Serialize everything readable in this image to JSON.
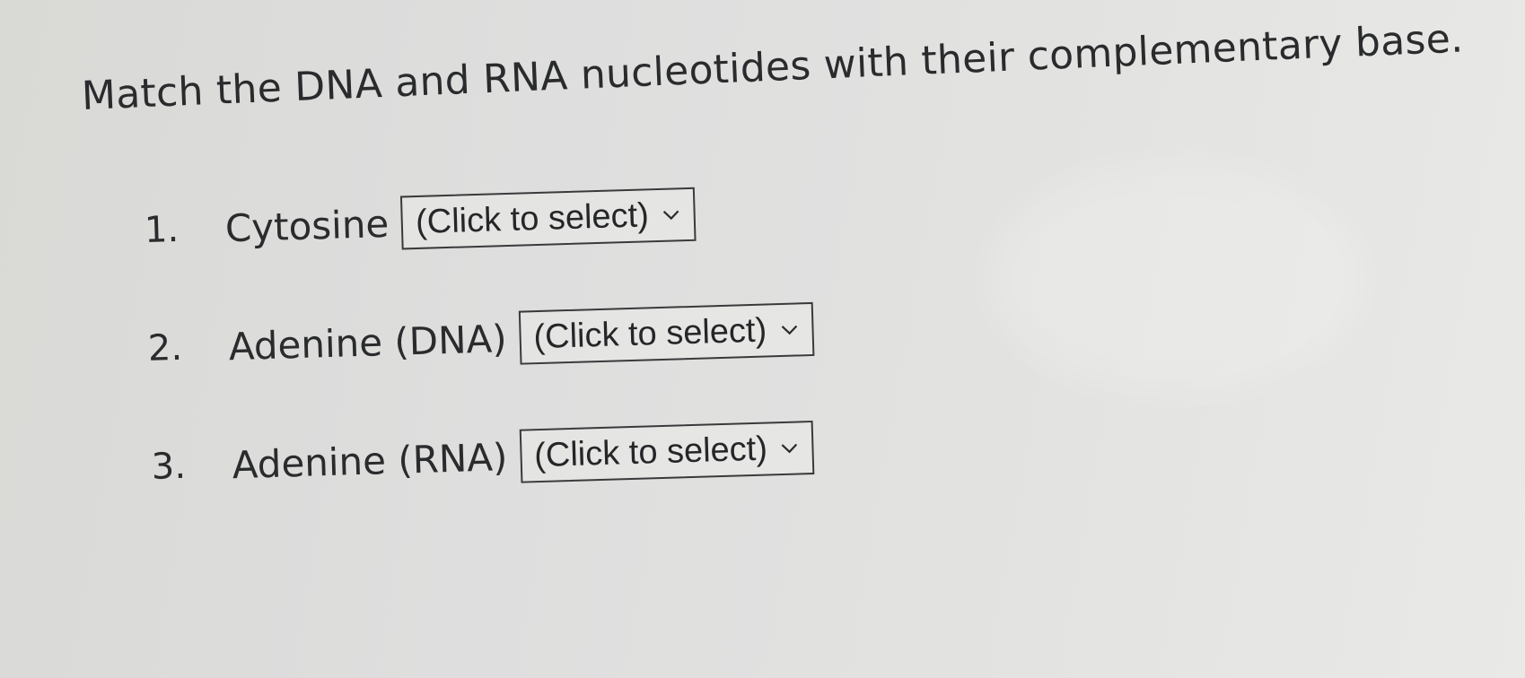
{
  "question": {
    "text": "Match the DNA and RNA nucleotides with their complementary base."
  },
  "items": [
    {
      "number": "1.",
      "label": "Cytosine",
      "select_value": "(Click to select)"
    },
    {
      "number": "2.",
      "label": "Adenine (DNA)",
      "select_value": "(Click to select)"
    },
    {
      "number": "3.",
      "label": "Adenine (RNA)",
      "select_value": "(Click to select)"
    }
  ],
  "icons": {
    "dropdown": "chevron-down-icon"
  }
}
